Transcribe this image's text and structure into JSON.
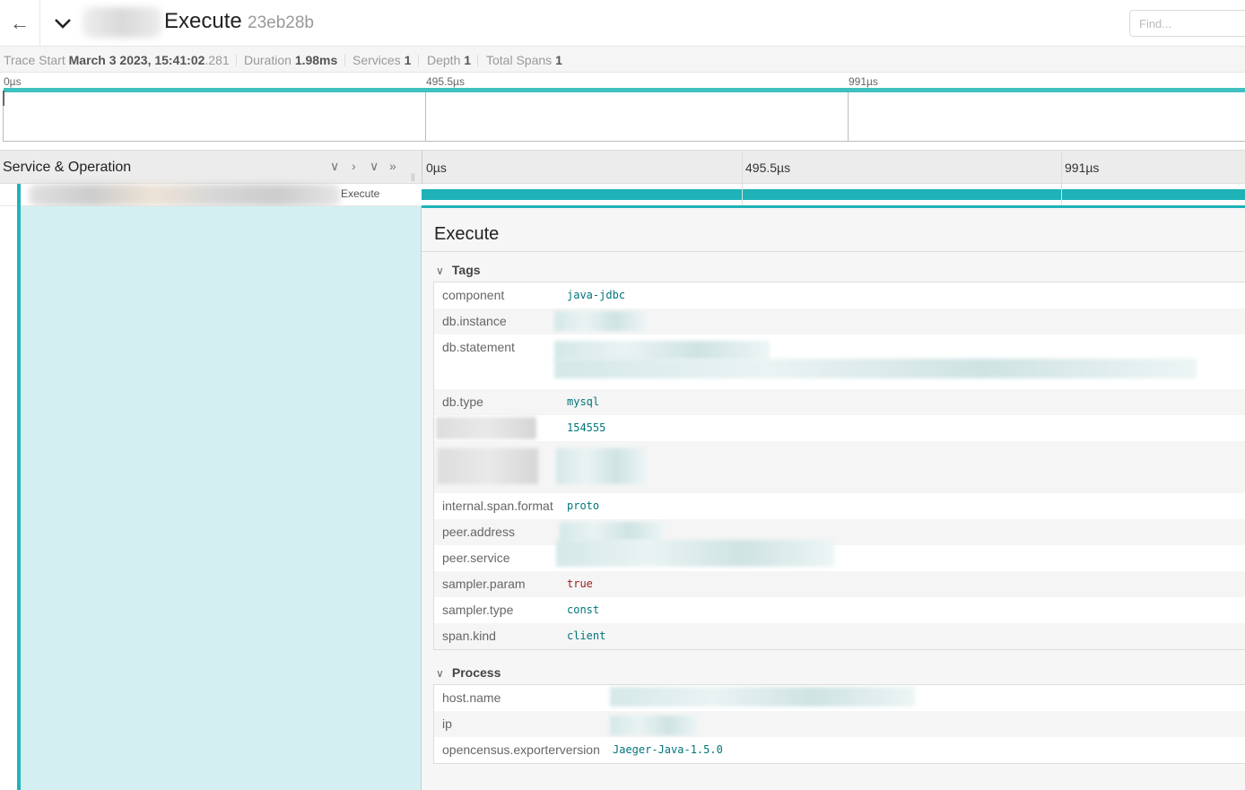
{
  "header": {
    "title": "Execute",
    "trace_id": "23eb28b",
    "find_placeholder": "Find..."
  },
  "overview": {
    "trace_start_label": "Trace Start",
    "trace_start_date": "March 3 2023, 15:41:02",
    "trace_start_ms": ".281",
    "duration_label": "Duration",
    "duration_value": "1.98ms",
    "services_label": "Services",
    "services_value": "1",
    "depth_label": "Depth",
    "depth_value": "1",
    "total_spans_label": "Total Spans",
    "total_spans_value": "1"
  },
  "minimap": {
    "ticks": [
      "0µs",
      "495.5µs",
      "991µs"
    ]
  },
  "timeline": {
    "left_title": "Service & Operation",
    "ticks": [
      "0µs",
      "495.5µs",
      "991µs"
    ]
  },
  "span": {
    "operation": "Execute"
  },
  "detail": {
    "title": "Execute",
    "tags_label": "Tags",
    "process_label": "Process",
    "tags": [
      {
        "key": "component",
        "value": "java-jdbc"
      },
      {
        "key": "db.instance",
        "value": ""
      },
      {
        "key": "db.statement",
        "value": ""
      },
      {
        "key": "db.type",
        "value": "mysql"
      },
      {
        "key": "",
        "value": "154555"
      },
      {
        "key": "",
        "value": ""
      },
      {
        "key": "internal.span.format",
        "value": "proto"
      },
      {
        "key": "peer.address",
        "value": ""
      },
      {
        "key": "peer.service",
        "value": ""
      },
      {
        "key": "sampler.param",
        "value": "true"
      },
      {
        "key": "sampler.type",
        "value": "const"
      },
      {
        "key": "span.kind",
        "value": "client"
      }
    ],
    "process": [
      {
        "key": "host.name",
        "value": ""
      },
      {
        "key": "ip",
        "value": ""
      },
      {
        "key": "opencensus.exporterversion",
        "value": "Jaeger-Java-1.5.0"
      }
    ]
  },
  "colors": {
    "accent": "#1fb3b8",
    "tag_value": "#00757b",
    "bool_value": "#9b1c1c"
  }
}
